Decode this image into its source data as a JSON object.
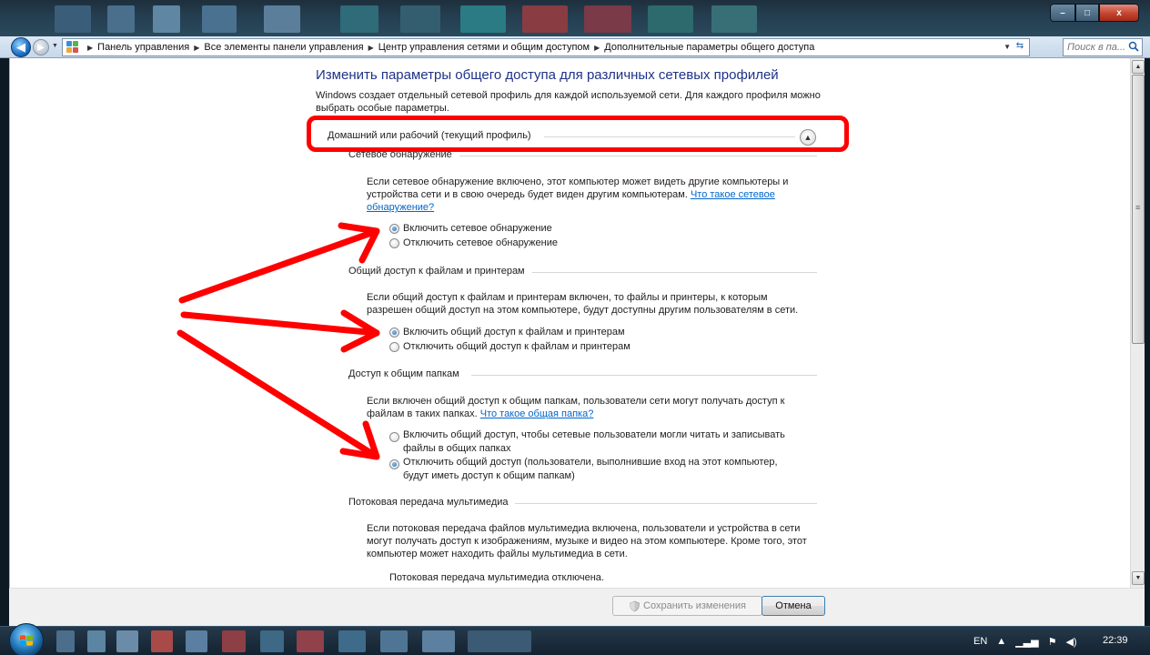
{
  "window": {
    "controls": {
      "minimize": "–",
      "maximize": "□",
      "close": "x"
    }
  },
  "address": {
    "crumbs": [
      "Панель управления",
      "Все элементы панели управления",
      "Центр управления сетями и общим доступом",
      "Дополнительные параметры общего доступа"
    ],
    "search_placeholder": "Поиск в па..."
  },
  "page": {
    "heading": "Изменить параметры общего доступа для различных сетевых профилей",
    "intro": "Windows создает отдельный сетевой профиль для каждой используемой сети. Для каждого профиля можно выбрать особые параметры.",
    "profile_header": "Домашний или рабочий (текущий профиль)",
    "sections": {
      "discovery": {
        "title": "Сетевое обнаружение",
        "description": "Если сетевое обнаружение включено, этот компьютер может видеть другие компьютеры и устройства сети и в свою очередь будет виден другим компьютерам.",
        "link": "Что такое сетевое обнаружение?",
        "options": [
          {
            "label": "Включить сетевое обнаружение",
            "checked": true
          },
          {
            "label": "Отключить сетевое обнаружение",
            "checked": false
          }
        ]
      },
      "file_printer": {
        "title": "Общий доступ к файлам и принтерам",
        "description": "Если общий доступ к файлам и принтерам включен, то файлы и принтеры, к которым разрешен общий доступ на этом компьютере, будут доступны другим пользователям в сети.",
        "options": [
          {
            "label": "Включить общий доступ к файлам и принтерам",
            "checked": true
          },
          {
            "label": "Отключить общий доступ к файлам и принтерам",
            "checked": false
          }
        ]
      },
      "public_folders": {
        "title": "Доступ к общим папкам",
        "description": "Если включен общий доступ к общим папкам, пользователи сети могут получать доступ к файлам в таких папках.",
        "link": "Что такое общая папка?",
        "options": [
          {
            "label": "Включить общий доступ, чтобы сетевые пользователи могли читать и записывать файлы в общих папках",
            "checked": false
          },
          {
            "label": "Отключить общий доступ (пользователи, выполнившие вход на этот компьютер, будут иметь доступ к общим папкам)",
            "checked": true
          }
        ]
      },
      "media": {
        "title": "Потоковая передача мультимедиа",
        "description": "Если потоковая передача файлов мультимедиа включена, пользователи и устройства в сети могут получать доступ к изображениям, музыке и видео на этом компьютере. Кроме того, этот компьютер может находить файлы мультимедиа в сети.",
        "status": "Потоковая передача мультимедиа отключена."
      }
    }
  },
  "footer": {
    "save_label": "Сохранить изменения",
    "cancel_label": "Отмена"
  },
  "taskbar": {
    "language": "EN",
    "clock": "22:39"
  },
  "colors": {
    "annotation": "#ff0000",
    "link": "#0066cc",
    "heading": "#1e3287"
  }
}
